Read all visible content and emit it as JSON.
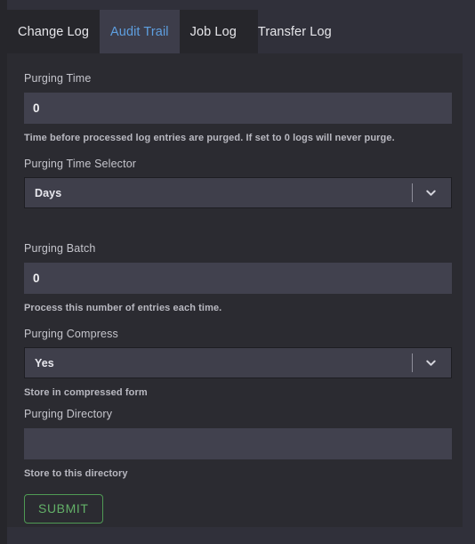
{
  "theme": {
    "page_bg": "#30303a",
    "panel_bg": "#2b2b31",
    "tabstrip_bg": "#26262b",
    "active_tab_bg": "#3d3d4a",
    "active_tab_color": "#5e9fe0",
    "input_bg": "#41414e",
    "select_bg": "#3f3f4b",
    "label_color": "#c5c5cc",
    "help_color": "#b9b9c1",
    "accent_green": "#63b068"
  },
  "tabs": [
    {
      "label": "Change Log",
      "active": false
    },
    {
      "label": "Audit Trail",
      "active": true
    },
    {
      "label": "Job Log",
      "active": false
    },
    {
      "label": "Transfer Log",
      "active": false
    }
  ],
  "form": {
    "purging_time": {
      "label": "Purging Time",
      "value": "0",
      "placeholder": "",
      "help": "Time before processed log entries are purged. If set to 0 logs will never purge."
    },
    "purging_time_selector": {
      "label": "Purging Time Selector",
      "value": "Days",
      "options": [
        "Days"
      ],
      "icon": "chevron-down-icon"
    },
    "purging_batch": {
      "label": "Purging Batch",
      "value": "0",
      "placeholder": "",
      "help": "Process this number of entries each time."
    },
    "purging_compress": {
      "label": "Purging Compress",
      "value": "Yes",
      "options": [
        "Yes"
      ],
      "icon": "chevron-down-icon",
      "help": "Store in compressed form"
    },
    "purging_directory": {
      "label": "Purging Directory",
      "value": "",
      "placeholder": "",
      "help": "Store to this directory"
    },
    "submit": {
      "label": "SUBMIT"
    }
  }
}
